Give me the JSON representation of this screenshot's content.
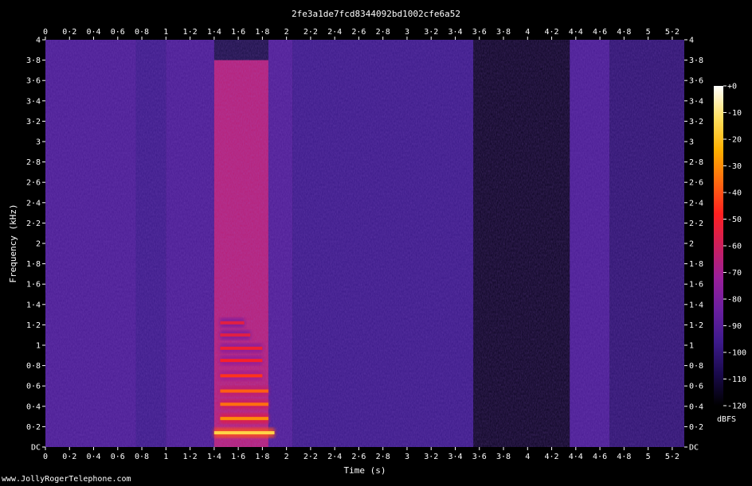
{
  "chart_data": {
    "type": "heatmap",
    "subtype": "spectrogram",
    "title": "2fe3a1de7fcd8344092bd1002cfe6a52",
    "xlabel": "Time (s)",
    "ylabel": "Frequency (kHz)",
    "xlim": [
      0,
      5.3
    ],
    "ylim": [
      0,
      4
    ],
    "x_ticks": [
      "0",
      "0·2",
      "0·4",
      "0·6",
      "0·8",
      "1",
      "1·2",
      "1·4",
      "1·6",
      "1·8",
      "2",
      "2·2",
      "2·4",
      "2·6",
      "2·8",
      "3",
      "3·2",
      "3·4",
      "3·6",
      "3·8",
      "4",
      "4·2",
      "4·4",
      "4·6",
      "4·8",
      "5",
      "5·2"
    ],
    "x_tick_values": [
      0,
      0.2,
      0.4,
      0.6,
      0.8,
      1,
      1.2,
      1.4,
      1.6,
      1.8,
      2,
      2.2,
      2.4,
      2.6,
      2.8,
      3,
      3.2,
      3.4,
      3.6,
      3.8,
      4,
      4.2,
      4.4,
      4.6,
      4.8,
      5,
      5.2
    ],
    "y_ticks": [
      "DC",
      "0·2",
      "0·4",
      "0·6",
      "0·8",
      "1",
      "1·2",
      "1·4",
      "1·6",
      "1·8",
      "2",
      "2·2",
      "2·4",
      "2·6",
      "2·8",
      "3",
      "3·2",
      "3·4",
      "3·6",
      "3·8",
      "4"
    ],
    "y_tick_values": [
      0,
      0.2,
      0.4,
      0.6,
      0.8,
      1,
      1.2,
      1.4,
      1.6,
      1.8,
      2,
      2.2,
      2.4,
      2.6,
      2.8,
      3,
      3.2,
      3.4,
      3.6,
      3.8,
      4
    ],
    "colorbar": {
      "label": "dBFS",
      "range": [
        -120,
        0
      ],
      "ticks": [
        "+0",
        "-10",
        "-20",
        "-30",
        "-40",
        "-50",
        "-60",
        "-70",
        "-80",
        "-90",
        "-100",
        "-110",
        "-120"
      ],
      "tick_values": [
        0,
        -10,
        -20,
        -30,
        -40,
        -50,
        -60,
        -70,
        -80,
        -90,
        -100,
        -110,
        -120
      ],
      "colormap": [
        "#000000",
        "#1a0a4d",
        "#3d1a8c",
        "#6a1fa0",
        "#9a1f9a",
        "#cc1f5c",
        "#ff2020",
        "#ff6a10",
        "#ffb000",
        "#ffe060",
        "#ffffff"
      ]
    },
    "regions": [
      {
        "t0": 0.0,
        "t1": 0.75,
        "f0": 0,
        "f1": 4,
        "level_db": -93
      },
      {
        "t0": 0.75,
        "t1": 1.0,
        "f0": 0,
        "f1": 4,
        "level_db": -97
      },
      {
        "t0": 1.0,
        "t1": 1.4,
        "f0": 0,
        "f1": 4,
        "level_db": -93
      },
      {
        "t0": 1.4,
        "t1": 1.85,
        "f0": 0,
        "f1": 3.8,
        "level_db": -65
      },
      {
        "t0": 1.85,
        "t1": 2.05,
        "f0": 0,
        "f1": 4,
        "level_db": -92
      },
      {
        "t0": 2.05,
        "t1": 3.55,
        "f0": 0,
        "f1": 4,
        "level_db": -97
      },
      {
        "t0": 3.55,
        "t1": 4.35,
        "f0": 0,
        "f1": 4,
        "level_db": -115
      },
      {
        "t0": 4.35,
        "t1": 4.68,
        "f0": 0,
        "f1": 4,
        "level_db": -93
      },
      {
        "t0": 4.68,
        "t1": 5.3,
        "f0": 0,
        "f1": 4,
        "level_db": -102
      }
    ],
    "harmonics": [
      {
        "t0": 1.4,
        "t1": 1.9,
        "f": 0.14,
        "level_db": -15
      },
      {
        "t0": 1.45,
        "t1": 1.85,
        "f": 0.28,
        "level_db": -30
      },
      {
        "t0": 1.45,
        "t1": 1.85,
        "f": 0.42,
        "level_db": -35
      },
      {
        "t0": 1.45,
        "t1": 1.85,
        "f": 0.55,
        "level_db": -38
      },
      {
        "t0": 1.45,
        "t1": 1.8,
        "f": 0.7,
        "level_db": -45
      },
      {
        "t0": 1.45,
        "t1": 1.8,
        "f": 0.85,
        "level_db": -50
      },
      {
        "t0": 1.45,
        "t1": 1.8,
        "f": 0.97,
        "level_db": -52
      },
      {
        "t0": 1.45,
        "t1": 1.7,
        "f": 1.1,
        "level_db": -55
      },
      {
        "t0": 1.45,
        "t1": 1.65,
        "f": 1.22,
        "level_db": -55
      }
    ]
  },
  "watermark": "www.JollyRogerTelephone.com"
}
